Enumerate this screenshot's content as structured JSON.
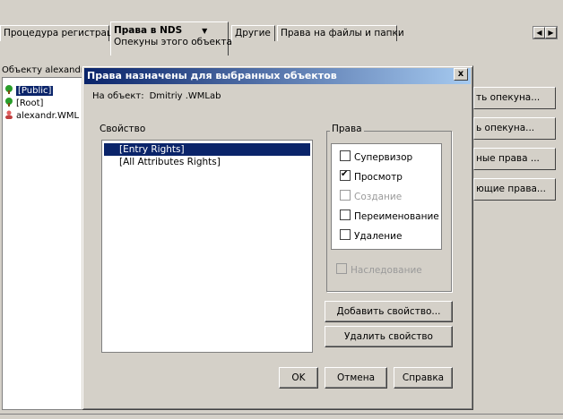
{
  "tabs": [
    {
      "label": "Процедура регистрации"
    },
    {
      "label": "Права в NDS",
      "sub": "Опекуны этого объекта",
      "caret": "▼"
    },
    {
      "label": "Другие"
    },
    {
      "label": "Права на файлы и папки"
    }
  ],
  "objects_label": "Объекту alexandr.W",
  "objects": [
    {
      "label": "[Public]"
    },
    {
      "label": "[Root]"
    },
    {
      "label": "alexandr.WML"
    }
  ],
  "right_buttons": [
    {
      "label": "ть опекуна..."
    },
    {
      "label": "ь опекуна..."
    },
    {
      "label": "ные права ..."
    },
    {
      "label": "ющие права..."
    }
  ],
  "dialog": {
    "title": "Права назначены для выбранных объектов",
    "close": "x",
    "on_object_label": "На объект:",
    "on_object_value": "Dmitriy .WMLab",
    "property_label": "Свойство",
    "properties": [
      "[Entry Rights]",
      "[All Attributes Rights]"
    ],
    "rights_label": "Права",
    "rights": [
      {
        "label": "Супервизор",
        "checked": false,
        "disabled": false
      },
      {
        "label": "Просмотр",
        "checked": true,
        "disabled": false
      },
      {
        "label": "Создание",
        "checked": false,
        "disabled": true
      },
      {
        "label": "Переименование",
        "checked": false,
        "disabled": false
      },
      {
        "label": "Удаление",
        "checked": false,
        "disabled": false
      }
    ],
    "inheritance_label": "Наследование",
    "add_property": "Добавить свойство...",
    "remove_property": "Удалить свойство",
    "ok": "OK",
    "cancel": "Отмена",
    "help": "Справка"
  },
  "colors": {
    "face": "#d4d0c8",
    "selection": "#0a246a",
    "title_start": "#0a246a",
    "title_end": "#a6caf0"
  }
}
